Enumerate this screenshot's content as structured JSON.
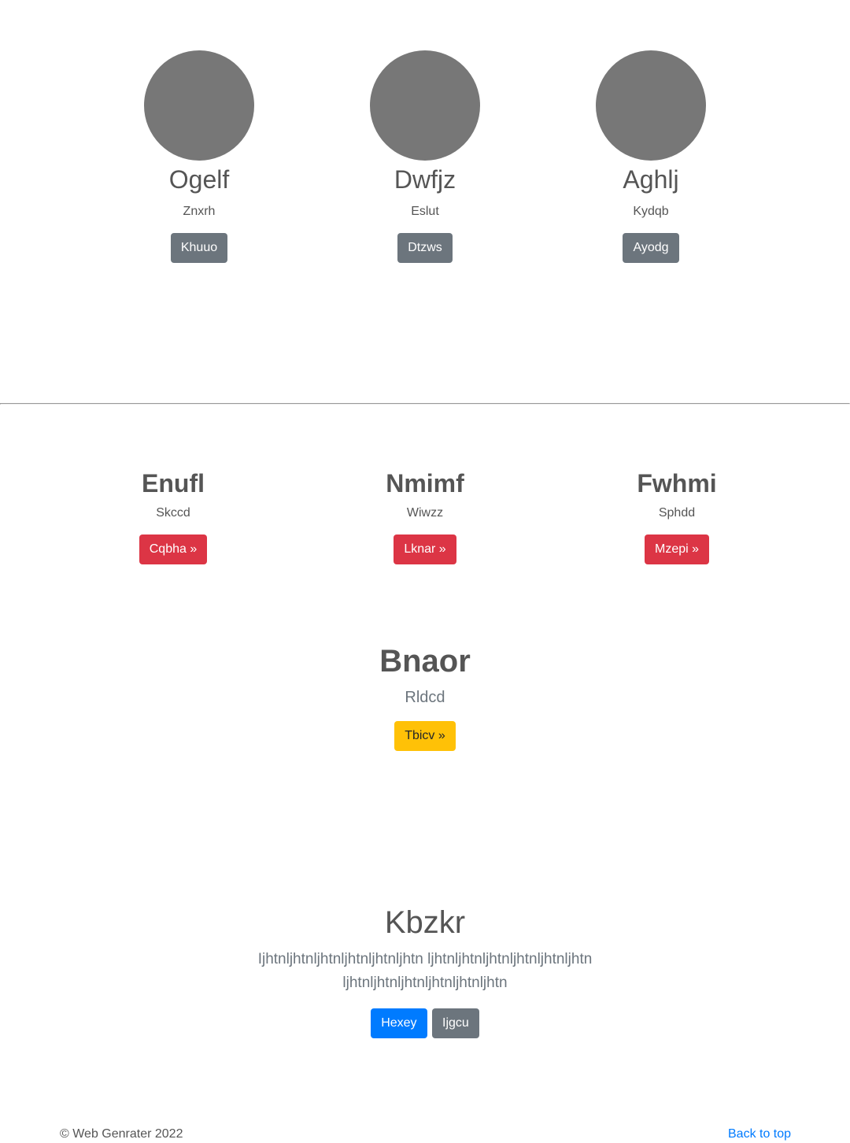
{
  "profiles": [
    {
      "name": "Ogelf",
      "subtitle": "Znxrh",
      "button": "Khuuo"
    },
    {
      "name": "Dwfjz",
      "subtitle": "Eslut",
      "button": "Dtzws"
    },
    {
      "name": "Aghlj",
      "subtitle": "Kydqb",
      "button": "Ayodg"
    }
  ],
  "features": [
    {
      "title": "Enufl",
      "subtitle": "Skccd",
      "button": "Cqbha »"
    },
    {
      "title": "Nmimf",
      "subtitle": "Wiwzz",
      "button": "Lknar »"
    },
    {
      "title": "Fwhmi",
      "subtitle": "Sphdd",
      "button": "Mzepi »"
    }
  ],
  "highlight": {
    "title": "Bnaor",
    "subtitle": "Rldcd",
    "button": "Tbicv »"
  },
  "jumbotron": {
    "title": "Kbzkr",
    "lead": "Ijhtnljhtnljhtnljhtnljhtnljhtn ljhtnljhtnljhtnljhtnljhtnljhtn ljhtnljhtnljhtnljhtnljhtnljhtn",
    "primary_button": "Hexey",
    "secondary_button": "Ijgcu"
  },
  "footer": {
    "copyright": "© Web Genrater 2022",
    "back_to_top": "Back to top"
  },
  "colors": {
    "avatar": "#777777",
    "secondary": "#6c757d",
    "danger": "#dc3545",
    "warning": "#ffc107",
    "primary": "#007bff"
  }
}
